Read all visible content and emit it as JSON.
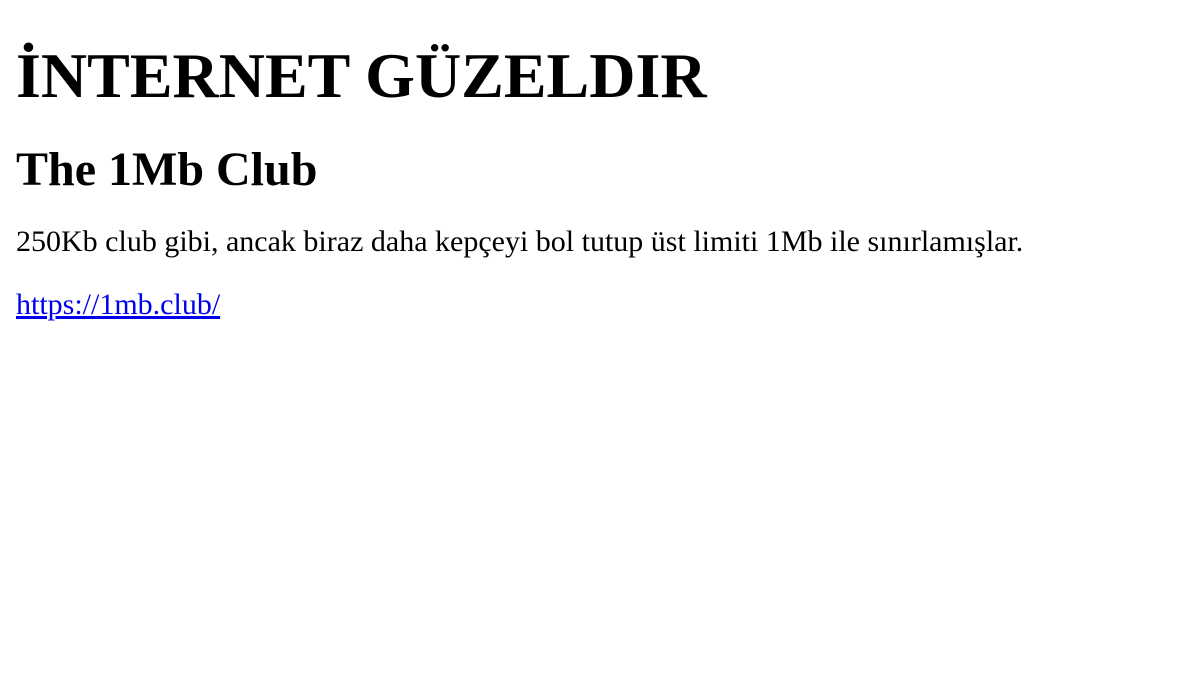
{
  "site": {
    "title": "İNTERNET GÜZELDIR"
  },
  "post": {
    "title": "The 1Mb Club",
    "text": "250Kb club gibi, ancak biraz daha kepçeyi bol tutup üst limiti 1Mb ile sınırlamışlar.",
    "link_text": "https://1mb.club/",
    "link_href": "https://1mb.club/",
    "link_color": "#0000ee"
  }
}
